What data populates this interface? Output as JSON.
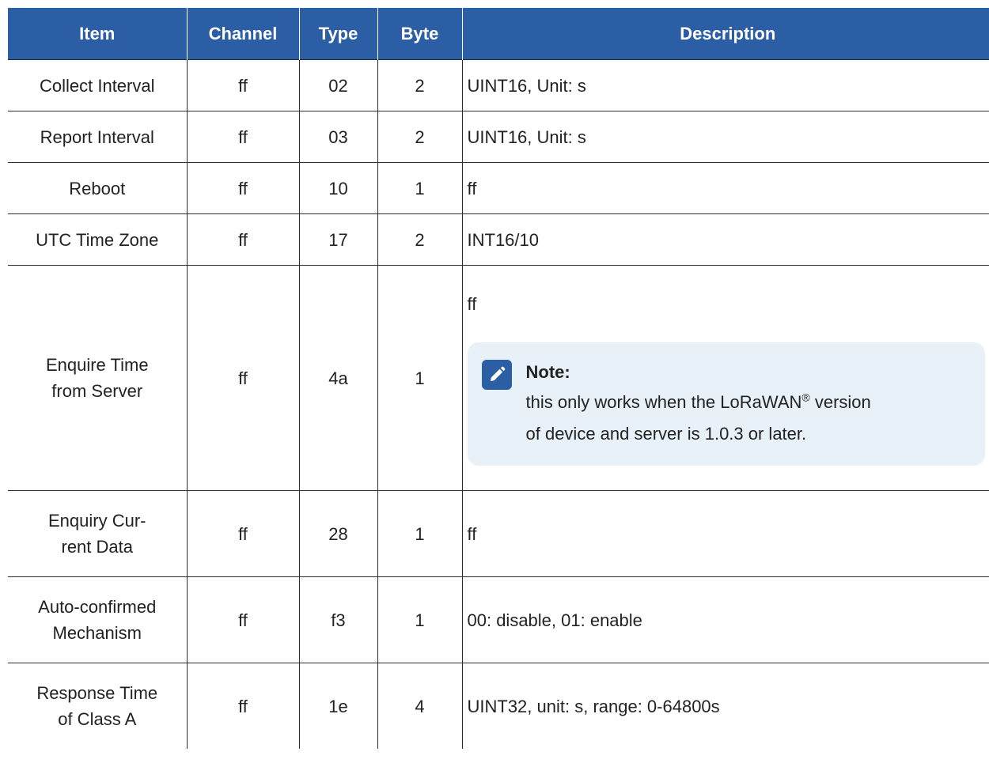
{
  "headers": {
    "item": "Item",
    "channel": "Channel",
    "type": "Type",
    "byte": "Byte",
    "description": "Description"
  },
  "rows": [
    {
      "item": "Collect Interval",
      "channel": "ff",
      "type": "02",
      "byte": "2",
      "description": "UINT16, Unit: s"
    },
    {
      "item": "Report Interval",
      "channel": "ff",
      "type": "03",
      "byte": "2",
      "description": "UINT16, Unit: s"
    },
    {
      "item": "Reboot",
      "channel": "ff",
      "type": "10",
      "byte": "1",
      "description": "ff"
    },
    {
      "item": "UTC Time Zone",
      "channel": "ff",
      "type": "17",
      "byte": "2",
      "description": "INT16/10"
    },
    {
      "item_line1": "Enquire Time",
      "item_line2": "from Server",
      "channel": "ff",
      "type": "4a",
      "byte": "1",
      "description": "ff",
      "note": {
        "title": "Note:",
        "text_before": "this only works when the LoRaWAN",
        "superscript": "®",
        "text_after": " version",
        "text_line2": "of device and server is 1.0.3 or later.",
        "icon": "pencil-icon",
        "accent": "#2c5ea5",
        "background": "#e8f0f8"
      }
    },
    {
      "item_line1": "Enquiry Cur-",
      "item_line2": "rent Data",
      "channel": "ff",
      "type": "28",
      "byte": "1",
      "description": "ff"
    },
    {
      "item_line1": "Auto-confirmed",
      "item_line2": "Mechanism",
      "channel": "ff",
      "type": "f3",
      "byte": "1",
      "description": "00: disable, 01: enable"
    },
    {
      "item_line1": "Response Time",
      "item_line2": "of Class A",
      "channel": "ff",
      "type": "1e",
      "byte": "4",
      "description": "UINT32, unit: s, range: 0-64800s"
    }
  ],
  "colors": {
    "header_bg": "#2c5ea5",
    "header_text": "#ffffff",
    "border": "#2b2b2b"
  }
}
